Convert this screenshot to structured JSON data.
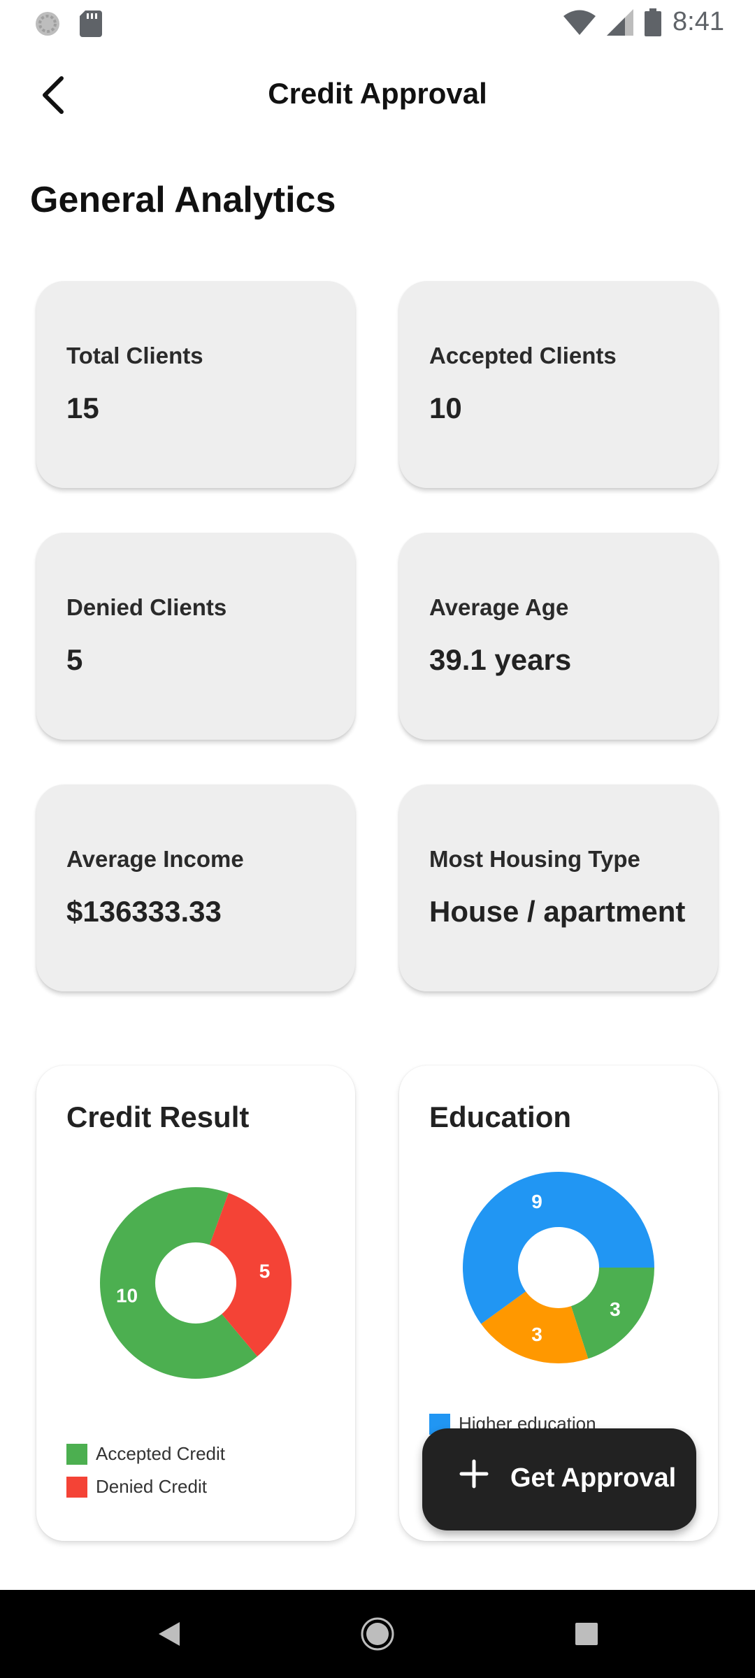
{
  "status_bar": {
    "time": "8:41"
  },
  "app_bar": {
    "title": "Credit Approval"
  },
  "section_title": "General Analytics",
  "stats": [
    {
      "label": "Total Clients",
      "value": "15"
    },
    {
      "label": "Accepted Clients",
      "value": "10"
    },
    {
      "label": "Denied Clients",
      "value": "5"
    },
    {
      "label": "Average Age",
      "value": "39.1 years"
    },
    {
      "label": "Average Income",
      "value": "$136333.33"
    },
    {
      "label": "Most Housing Type",
      "value": "House / apartment"
    }
  ],
  "charts": [
    {
      "title": "Credit Result",
      "legend": [
        "Accepted Credit",
        "Denied Credit"
      ]
    },
    {
      "title": "Education",
      "legend": [
        "Higher education"
      ]
    }
  ],
  "chart_data": [
    {
      "type": "pie",
      "title": "Credit Result",
      "categories": [
        "Accepted Credit",
        "Denied Credit"
      ],
      "values": [
        10,
        5
      ],
      "colors": [
        "#4CAF50",
        "#F44336"
      ]
    },
    {
      "type": "pie",
      "title": "Education",
      "categories": [
        "",
        "",
        "Higher education"
      ],
      "values": [
        3,
        3,
        9
      ],
      "colors": [
        "#4CAF50",
        "#FF9800",
        "#2196F3"
      ]
    }
  ],
  "fab": {
    "label": "Get Approval"
  },
  "colors": {
    "card_bg": "#eeeeee",
    "fab_bg": "#222222",
    "nav_bg": "#000000"
  }
}
